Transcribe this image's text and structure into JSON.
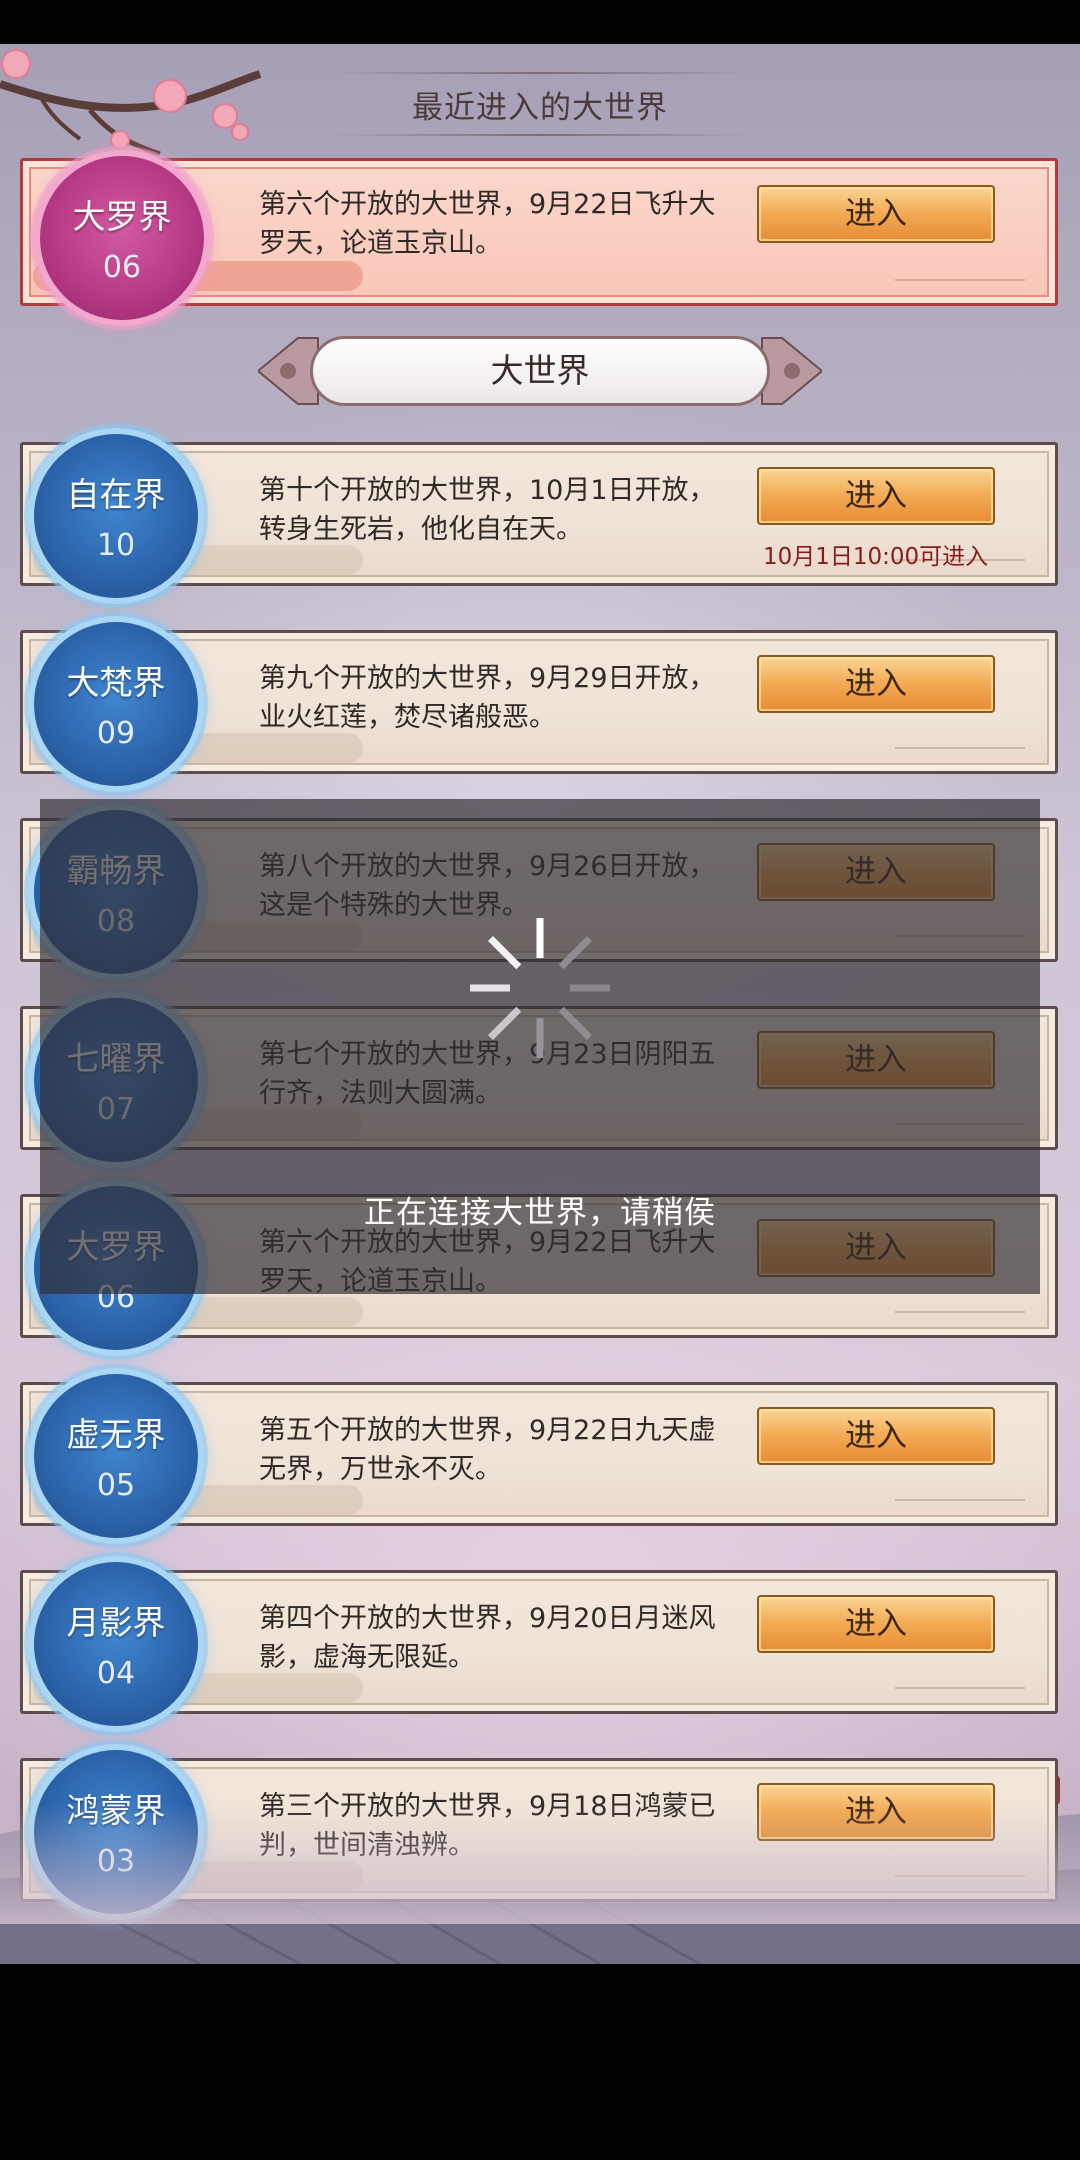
{
  "recent": {
    "title": "最近进入的大世界",
    "world": {
      "name": "大罗界",
      "num": "06",
      "desc": "第六个开放的大世界，9月22日飞升大罗天，论道玉京山。",
      "button": "进入"
    }
  },
  "list_title": "大世界",
  "worlds": [
    {
      "name": "自在界",
      "num": "10",
      "desc": "第十个开放的大世界，10月1日开放，转身生死岩，他化自在天。",
      "button": "进入",
      "note": "10月1日10:00可进入"
    },
    {
      "name": "大梵界",
      "num": "09",
      "desc": "第九个开放的大世界，9月29日开放，业火红莲，焚尽诸般恶。",
      "button": "进入"
    },
    {
      "name": "霸畅界",
      "num": "08",
      "desc": "第八个开放的大世界，9月26日开放，这是个特殊的大世界。",
      "button": "进入"
    },
    {
      "name": "七曜界",
      "num": "07",
      "desc": "第七个开放的大世界，9月23日阴阳五行齐，法则大圆满。",
      "button": "进入"
    },
    {
      "name": "大罗界",
      "num": "06",
      "desc": "第六个开放的大世界，9月22日飞升大罗天，论道玉京山。",
      "button": "进入"
    },
    {
      "name": "虚无界",
      "num": "05",
      "desc": "第五个开放的大世界，9月22日九天虚无界，万世永不灭。",
      "button": "进入"
    },
    {
      "name": "月影界",
      "num": "04",
      "desc": "第四个开放的大世界，9月20日月迷风影，虚海无限延。",
      "button": "进入"
    },
    {
      "name": "鸿蒙界",
      "num": "03",
      "desc": "第三个开放的大世界，9月18日鸿蒙已判，世间清浊辨。",
      "button": "进入"
    }
  ],
  "loading": {
    "text": "正在连接大世界，请稍侯"
  }
}
